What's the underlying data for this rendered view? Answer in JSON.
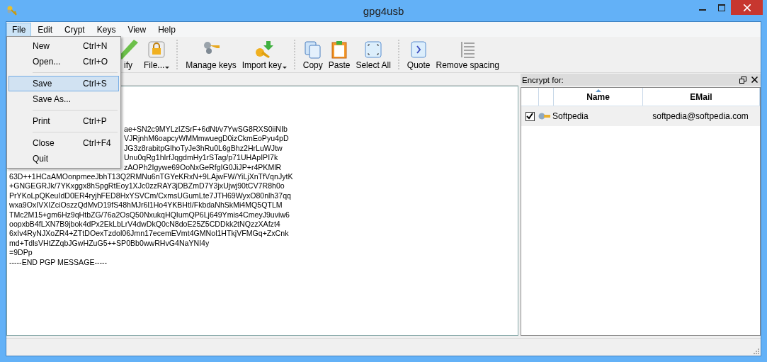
{
  "window": {
    "title": "gpg4usb"
  },
  "menu_bar": [
    {
      "label": "File",
      "selected": true
    },
    {
      "label": "Edit",
      "selected": false
    },
    {
      "label": "Crypt",
      "selected": false
    },
    {
      "label": "Keys",
      "selected": false
    },
    {
      "label": "View",
      "selected": false
    },
    {
      "label": "Help",
      "selected": false
    }
  ],
  "file_menu": [
    {
      "kind": "item",
      "label": "New",
      "shortcut": "Ctrl+N",
      "selected": false
    },
    {
      "kind": "item",
      "label": "Open...",
      "shortcut": "Ctrl+O",
      "selected": false
    },
    {
      "kind": "separator"
    },
    {
      "kind": "item",
      "label": "Save",
      "shortcut": "Ctrl+S",
      "selected": true
    },
    {
      "kind": "item",
      "label": "Save As...",
      "selected": false
    },
    {
      "kind": "separator"
    },
    {
      "kind": "item",
      "label": "Print",
      "shortcut": "Ctrl+P",
      "selected": false
    },
    {
      "kind": "separator"
    },
    {
      "kind": "item",
      "label": "Close",
      "shortcut": "Ctrl+F4",
      "selected": false
    },
    {
      "kind": "item",
      "label": "Quit",
      "selected": false
    }
  ],
  "toolbar": [
    {
      "kind": "verify",
      "label": "ify"
    },
    {
      "kind": "lock",
      "label": "File...",
      "dropdown": true
    },
    {
      "kind": "separator"
    },
    {
      "kind": "keys",
      "label": "Manage keys"
    },
    {
      "kind": "import",
      "label": "Import key",
      "dropdown": true
    },
    {
      "kind": "separator"
    },
    {
      "kind": "copy",
      "label": "Copy"
    },
    {
      "kind": "paste",
      "label": "Paste"
    },
    {
      "kind": "selectall",
      "label": "Select All"
    },
    {
      "kind": "separator"
    },
    {
      "kind": "quote",
      "label": "Quote"
    },
    {
      "kind": "spacing",
      "label": "Remove spacing"
    }
  ],
  "editor_lines": [
    {
      "kind": "partial",
      "text": "ae+SN2c9MYLzIZSrF+6dNt/v7YwSG8RXS0iiNIb"
    },
    {
      "kind": "partial",
      "text": "VJRjnhM6oapcyWMMmwuegD0izCkmEoPyu4pD"
    },
    {
      "kind": "partial",
      "text": "JG3z8rabitpGlhoTyJe3hRu0L6gBhz2HrLuWJtw"
    },
    {
      "kind": "partial",
      "text": "Unu0qRg1hIrfJqgdmHy1rSTag/p71UHApIPI7k"
    },
    {
      "kind": "partial",
      "text": "zAOPh2Igywe69OoNxGeRfgIG0JiJP+r4PKMlR"
    },
    {
      "kind": "full",
      "text": "63D++1HCaAMOonpmeeJbhT13Q2RMNu6nTGYeKRxN+9LAjwFW/YiLjXnTfVqnJytK"
    },
    {
      "kind": "full",
      "text": "+GNGEGRJk/7YKxggx8hSpgRtEoy1XJc0zzRAY3jDBZmD7Y3jxUjwj90tCV7R8h0o"
    },
    {
      "kind": "full",
      "text": "PrYKoLpQKeuIdD0ER4ryjhFED8HxYSVCm/CxmsUGumLte7JTH69WyxO80nlh37qq"
    },
    {
      "kind": "full",
      "text": "wxa9OxIVXIZciOszzQdMvD19fS48hMJr6l1Ho4YKBHtI/FkbdaNhSkMi4MQ5QTLM"
    },
    {
      "kind": "full",
      "text": "TMc2M15+gm6Hz9qHtbZG/76a2OsQ50NxukqHQIumQP6Lj649Ymis4CmeyJ9uviw6"
    },
    {
      "kind": "full",
      "text": "oopxbB4fLXN7B9jbok4dPx2EkLbLrV4dwDkQ0cN8doE25Z5CDDkk2tNQzzXAfzt4"
    },
    {
      "kind": "full",
      "text": "6xIv4RyNJXoZR4+ZTtDOexTzdol06Jmn17ecemEVmt4GMNol1HTkjVFMGq+ZxCnk"
    },
    {
      "kind": "full",
      "text": "md+TdlsVHtZZqbJGwHZuG5++SP0Bb0wwRHvG4NaYNI4y"
    },
    {
      "kind": "full",
      "text": "=9DPp"
    },
    {
      "kind": "full",
      "text": "-----END PGP MESSAGE-----"
    }
  ],
  "encrypt_panel": {
    "title": "Encrypt for:",
    "columns": [
      "Name",
      "EMail"
    ],
    "rows": [
      {
        "checked": true,
        "name": "Softpedia",
        "email": "softpedia@softpedia.com"
      }
    ]
  }
}
